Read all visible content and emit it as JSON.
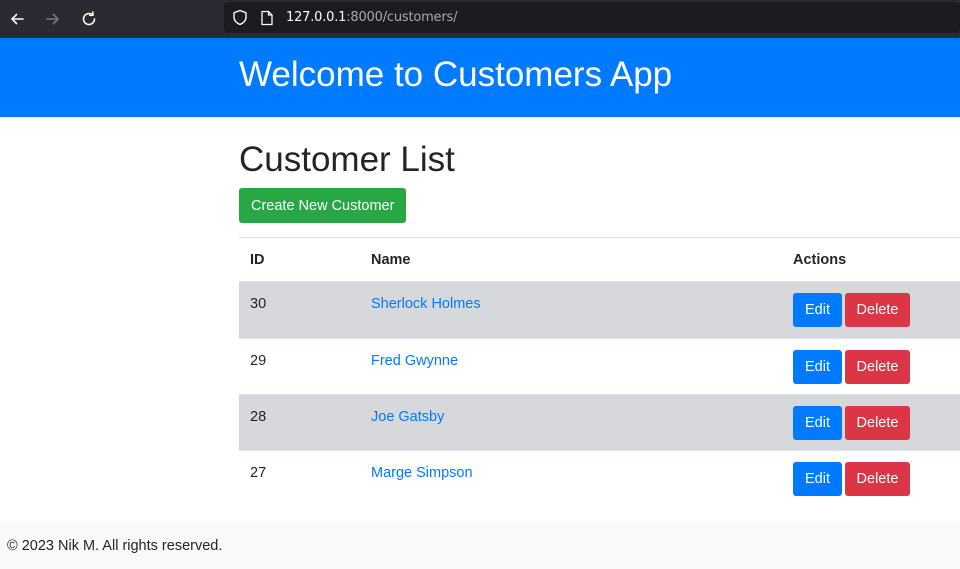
{
  "browser": {
    "url_host": "127.0.0.1",
    "url_rest": ":8000/customers/"
  },
  "header": {
    "title": "Welcome to Customers App"
  },
  "main": {
    "title": "Customer List",
    "create_label": "Create New Customer"
  },
  "table": {
    "columns": [
      "ID",
      "Name",
      "Actions"
    ],
    "edit_label": "Edit",
    "delete_label": "Delete",
    "rows": [
      {
        "id": "30",
        "name": "Sherlock Holmes"
      },
      {
        "id": "29",
        "name": "Fred Gwynne"
      },
      {
        "id": "28",
        "name": "Joe Gatsby"
      },
      {
        "id": "27",
        "name": "Marge Simpson"
      }
    ]
  },
  "footer": {
    "text": "© 2023 Nik M. All rights reserved."
  },
  "colors": {
    "primary": "#007bff",
    "success": "#28a745",
    "danger": "#dc3545",
    "stripe": "#d6d8db",
    "chrome": "#2b2a33"
  },
  "icons": [
    "back-arrow-icon",
    "forward-arrow-icon",
    "reload-icon",
    "shield-icon",
    "page-icon"
  ]
}
